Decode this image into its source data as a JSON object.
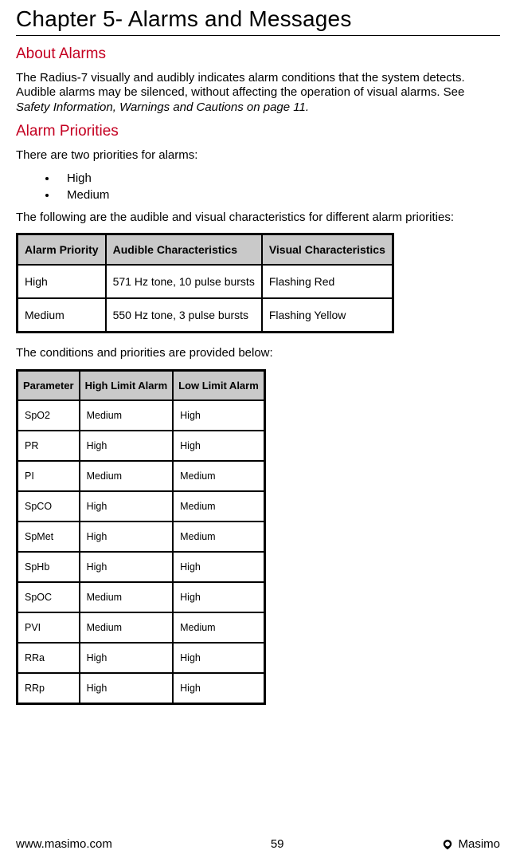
{
  "chapter_title": "Chapter 5- Alarms and Messages",
  "sections": {
    "about": {
      "heading": "About Alarms",
      "paragraph": "The Radius-7 visually and audibly indicates alarm conditions that the system detects. Audible alarms may be silenced, without affecting the operation of visual alarms. See ",
      "paragraph_italic": "Safety Information, Warnings and Cautions on page 11."
    },
    "priorities": {
      "heading": "Alarm Priorities",
      "intro": "There are two priorities for alarms:",
      "bullets": [
        "High",
        "Medium"
      ],
      "followup": "The following are the audible and visual characteristics for different alarm priorities:"
    },
    "table1": {
      "headers": [
        "Alarm Priority",
        "Audible Characteristics",
        "Visual Characteristics"
      ],
      "rows": [
        [
          "High",
          "571 Hz tone, 10 pulse bursts",
          "Flashing Red"
        ],
        [
          "Medium",
          "550 Hz tone, 3 pulse bursts",
          "Flashing Yellow"
        ]
      ]
    },
    "conditions_intro": "The conditions and priorities are provided below:",
    "table2": {
      "headers": [
        "Parameter",
        "High Limit Alarm",
        "Low Limit Alarm"
      ],
      "rows": [
        [
          "SpO2",
          "Medium",
          "High"
        ],
        [
          "PR",
          "High",
          "High"
        ],
        [
          "PI",
          "Medium",
          "Medium"
        ],
        [
          "SpCO",
          "High",
          "Medium"
        ],
        [
          "SpMet",
          "High",
          "Medium"
        ],
        [
          "SpHb",
          "High",
          "High"
        ],
        [
          "SpOC",
          "Medium",
          "High"
        ],
        [
          "PVI",
          "Medium",
          "Medium"
        ],
        [
          "RRa",
          "High",
          "High"
        ],
        [
          "RRp",
          "High",
          "High"
        ]
      ]
    }
  },
  "footer": {
    "left": "www.masimo.com",
    "center": "59",
    "right": "Masimo"
  }
}
